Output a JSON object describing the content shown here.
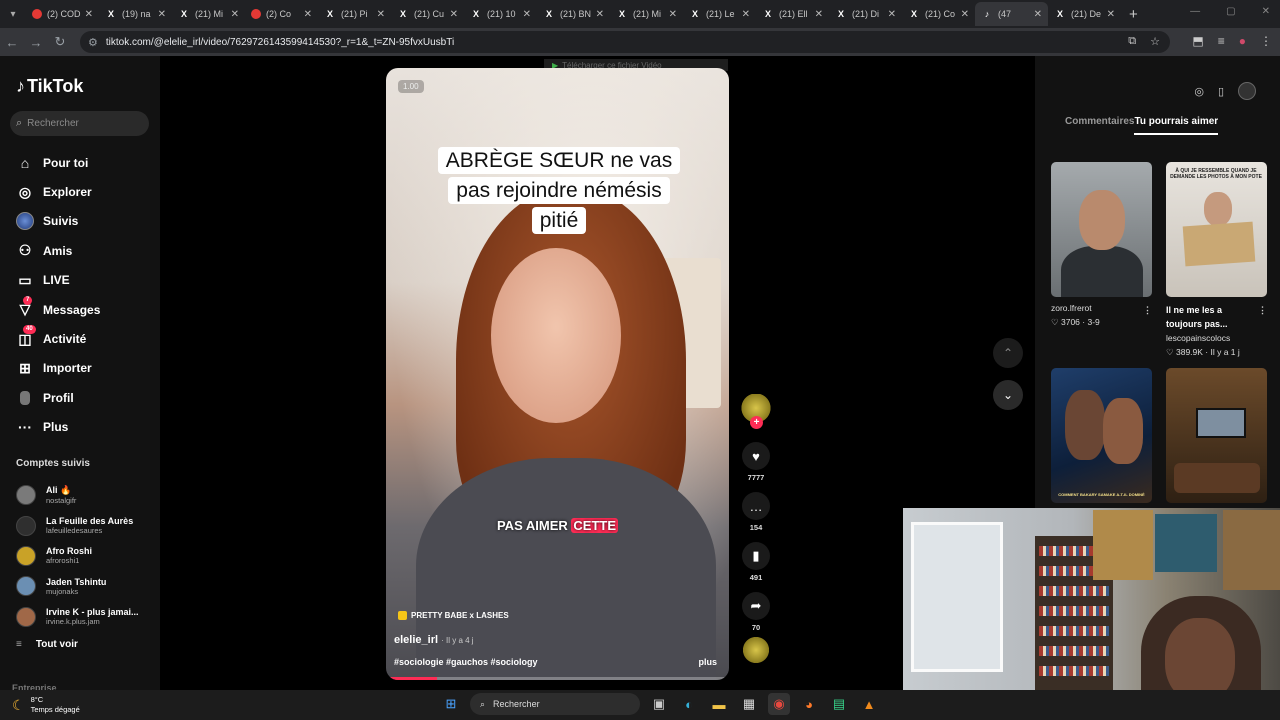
{
  "browser": {
    "tabs": [
      {
        "label": "(2) COD",
        "icon": "youtube-icon"
      },
      {
        "label": "(19) na",
        "icon": "x-icon"
      },
      {
        "label": "(21) Mi",
        "icon": "x-icon"
      },
      {
        "label": "(2) Co",
        "icon": "youtube-icon"
      },
      {
        "label": "(21) Pi",
        "icon": "x-icon"
      },
      {
        "label": "(21) Cu",
        "icon": "x-icon"
      },
      {
        "label": "(21) 10",
        "icon": "x-icon"
      },
      {
        "label": "(21) BN",
        "icon": "x-icon"
      },
      {
        "label": "(21) Mi",
        "icon": "x-icon"
      },
      {
        "label": "(21) Le",
        "icon": "x-icon"
      },
      {
        "label": "(21) Ell",
        "icon": "x-icon"
      },
      {
        "label": "(21) Di",
        "icon": "x-icon"
      },
      {
        "label": "(21) Co",
        "icon": "x-icon"
      },
      {
        "label": "(47",
        "icon": "tiktok-icon"
      },
      {
        "label": "(21) De",
        "icon": "x-icon"
      }
    ],
    "url": "tiktok.com/@elelie_irl/video/7629726143599414530?_r=1&_t=ZN-95fvxUusbTi",
    "download_banner": "Télécharger ce fichier Vidéo"
  },
  "sidebar": {
    "brand": "TikTok",
    "search_placeholder": "Rechercher",
    "menu": [
      {
        "label": "Pour toi",
        "icon": "home-icon",
        "badge": ""
      },
      {
        "label": "Explorer",
        "icon": "compass-icon",
        "badge": ""
      },
      {
        "label": "Suivis",
        "icon": "following-avatar-icon",
        "badge": ""
      },
      {
        "label": "Amis",
        "icon": "friends-icon",
        "badge": ""
      },
      {
        "label": "LIVE",
        "icon": "live-icon",
        "badge": ""
      },
      {
        "label": "Messages",
        "icon": "messages-icon",
        "badge": "7"
      },
      {
        "label": "Activité",
        "icon": "activity-icon",
        "badge": "40"
      },
      {
        "label": "Importer",
        "icon": "upload-icon",
        "badge": ""
      },
      {
        "label": "Profil",
        "icon": "profile-icon",
        "badge": ""
      },
      {
        "label": "Plus",
        "icon": "more-icon",
        "badge": ""
      }
    ],
    "following_title": "Comptes suivis",
    "following": [
      {
        "name": "Ali 🔥",
        "handle": "nostalgifr",
        "color": "#7a7a7a"
      },
      {
        "name": "La Feuille des Aurès",
        "handle": "lafeuilledesaures",
        "color": "#2f2f2f"
      },
      {
        "name": "Afro Roshi",
        "handle": "afroroshi1",
        "color": "#c9a227"
      },
      {
        "name": "Jaden Tshintu",
        "handle": "mujonaks",
        "color": "#6b8fb3"
      },
      {
        "name": "Irvine K - plus jamai...",
        "handle": "irvine.k.plus.jam",
        "color": "#a06848"
      }
    ],
    "see_all": "Tout voir",
    "enterprise": "Entreprise"
  },
  "video": {
    "timestamp": "1.00",
    "caption_lines": [
      "ABRÈGE SŒUR ne vas",
      "pas rejoindre némésis",
      "pitié"
    ],
    "subtitle_prefix": "PAS AIMER",
    "subtitle_highlight": "CETTE",
    "music": "PRETTY BABE x LASHES",
    "author": "elelie_irl",
    "posted": "· Il y a 4 j",
    "hashtags": "#sociologie #gauchos #sociology",
    "more": "plus",
    "progress": 0.15
  },
  "actions": {
    "likes": "7777",
    "comments": "154",
    "saves": "491",
    "shares": "70"
  },
  "right_panel": {
    "tabs": [
      "Commentaires",
      "Tu pourrais aimer"
    ],
    "active_tab": 1,
    "cards": [
      {
        "title": "",
        "author": "zoro.lfrerot",
        "likes": "3706",
        "date": "3-9",
        "thumb_text": ""
      },
      {
        "title": "Il ne me les a toujours pas...",
        "author": "lescopainscolocs",
        "likes": "389.9K",
        "date": "Il y a 1 j",
        "thumb_text": "À QUI JE RESSEMBLE QUAND JE DEMANDE LES PHOTOS À MON POTE"
      },
      {
        "title": "",
        "author": "",
        "likes": "",
        "date": "",
        "thumb_text": "COMMENT BAKARY SAMAKE A-T-IL DOMINÉ"
      },
      {
        "title": "",
        "author": "",
        "likes": "",
        "date": "",
        "thumb_text": ""
      }
    ]
  },
  "taskbar": {
    "weather_temp": "8°C",
    "weather_desc": "Temps dégagé",
    "search": "Rechercher"
  },
  "colors": {
    "accent": "#fe2c55",
    "background": "#000000",
    "sidebar": "#121212"
  }
}
